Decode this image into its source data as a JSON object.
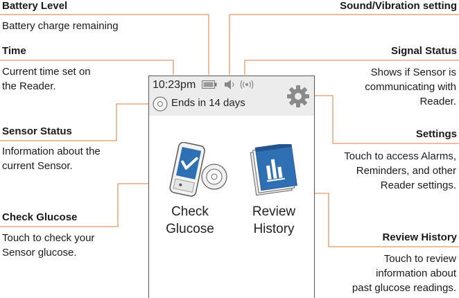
{
  "callouts": {
    "battery_level": {
      "title": "Battery Level",
      "desc": "Battery charge remaining"
    },
    "time": {
      "title": "Time",
      "desc_line1": "Current time set on",
      "desc_line2": "the Reader."
    },
    "sensor_status": {
      "title": "Sensor Status",
      "desc_line1": "Information about the",
      "desc_line2": "current Sensor."
    },
    "check_glucose": {
      "title": "Check Glucose",
      "desc_line1": "Touch to check your",
      "desc_line2": "Sensor glucose."
    },
    "sound_vibration": {
      "title": "Sound/Vibration setting"
    },
    "signal_status": {
      "title": "Signal Status",
      "desc_line1": "Shows if Sensor is",
      "desc_line2": "communicating with",
      "desc_line3": "Reader."
    },
    "settings": {
      "title": "Settings",
      "desc_line1": "Touch to access Alarms,",
      "desc_line2": "Reminders, and other",
      "desc_line3": "Reader settings."
    },
    "review_history": {
      "title": "Review History",
      "desc_line1": "Touch to review",
      "desc_line2": "information about",
      "desc_line3": "past glucose readings."
    }
  },
  "device": {
    "time": "10:23pm",
    "sensor_status": "Ends in 14 days",
    "buttons": {
      "check_glucose": {
        "line1": "Check",
        "line2": "Glucose"
      },
      "review_history": {
        "line1": "Review",
        "line2": "History"
      }
    }
  },
  "colors": {
    "accent_line": "#e07b39",
    "icon_blue": "#2f6fb3",
    "status_bar": "#ececec"
  },
  "icons": [
    "battery-icon",
    "speaker-icon",
    "signal-icon",
    "gear-icon",
    "sensor-icon",
    "reader-sensor-icon",
    "logbook-icon"
  ]
}
